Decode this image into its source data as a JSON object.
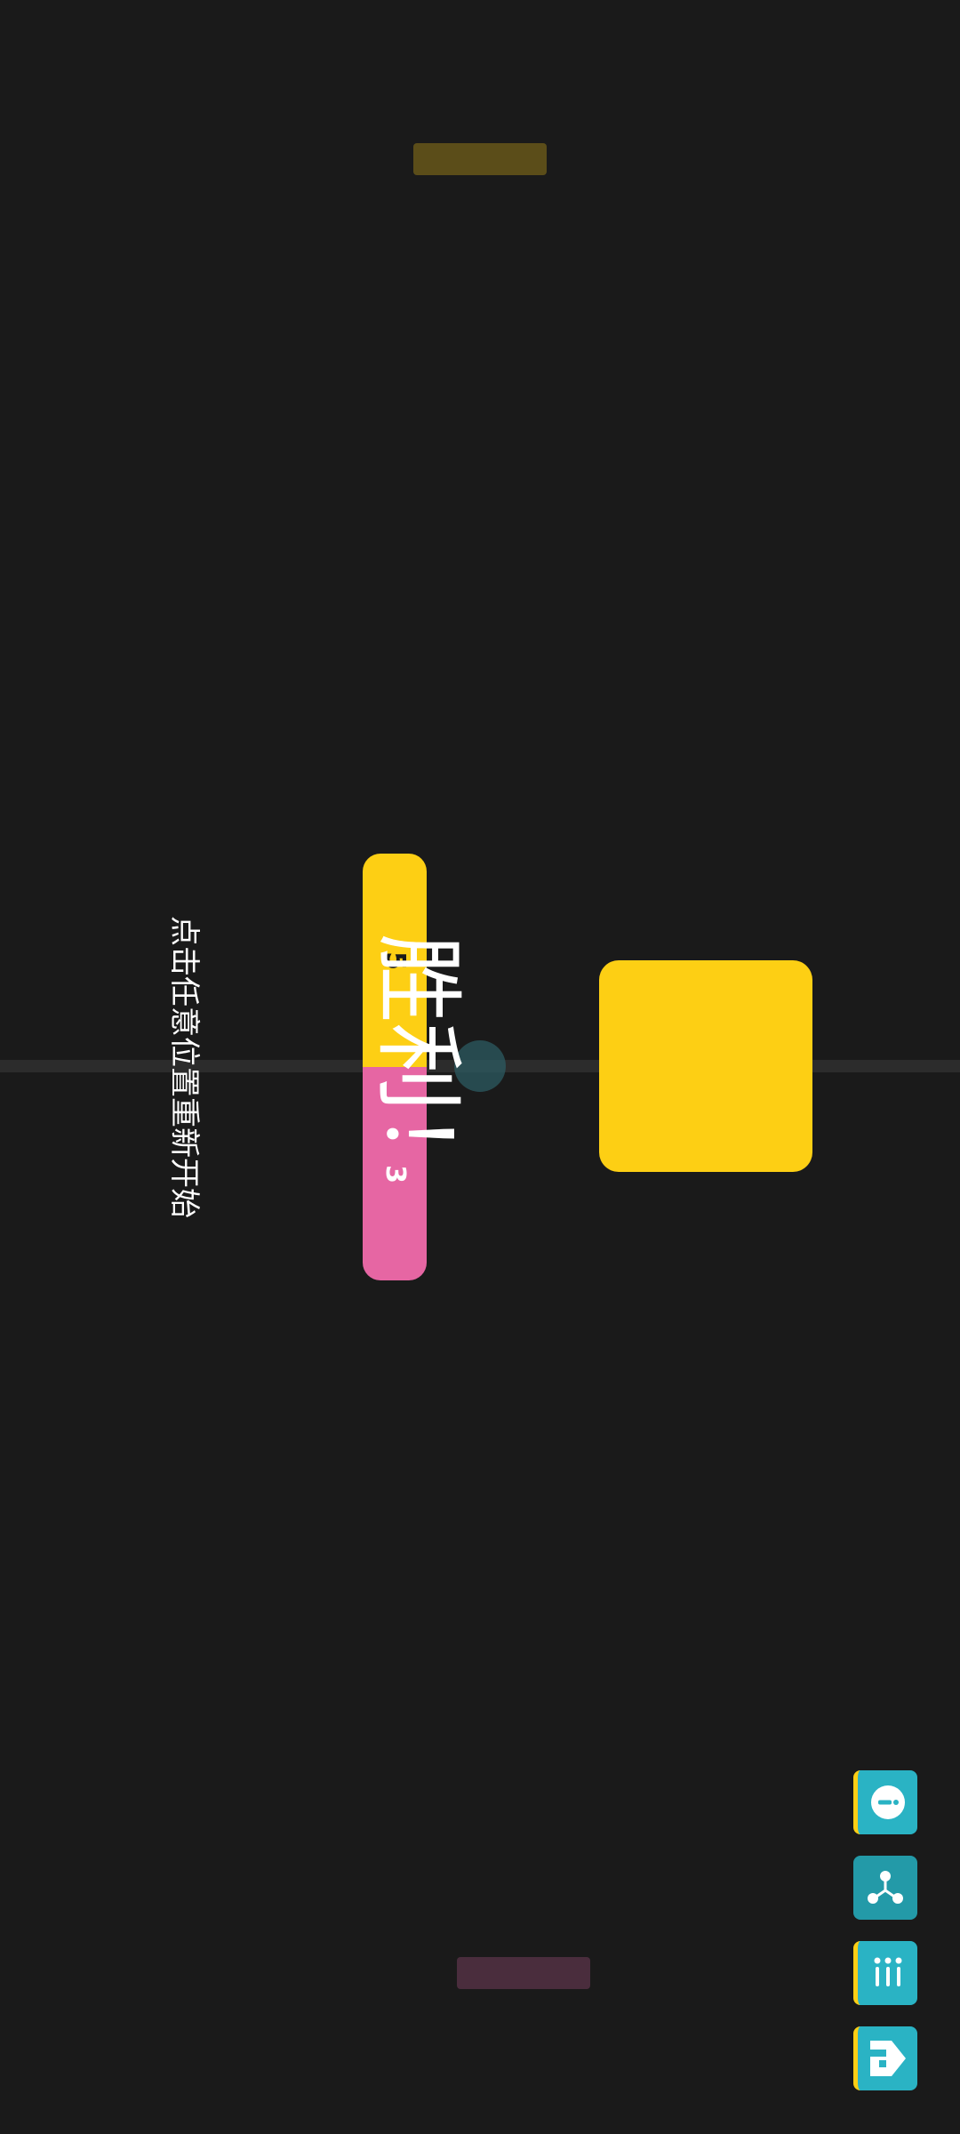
{
  "colors": {
    "background": "#1a1a1a",
    "yellow": "#fdcf14",
    "pink": "#e666a3",
    "teal": "#2ab3c4",
    "teal_dark": "#239aa8",
    "paddle_top": "#786419",
    "paddle_bottom": "#6b3a55",
    "ball": "#2c5b62"
  },
  "game": {
    "result_text": "胜利！",
    "restart_hint": "点击任意位置重新开始",
    "scores": {
      "yellow": "5",
      "pink": "3"
    },
    "winner": "yellow"
  },
  "toolbar": {
    "buttons": [
      {
        "name": "info-button",
        "icon": "info-icon",
        "marked": true
      },
      {
        "name": "share-button",
        "icon": "share-icon",
        "marked": false
      },
      {
        "name": "stats-button",
        "icon": "stats-icon",
        "marked": true
      },
      {
        "name": "home-button",
        "icon": "home-icon",
        "marked": true
      }
    ]
  }
}
